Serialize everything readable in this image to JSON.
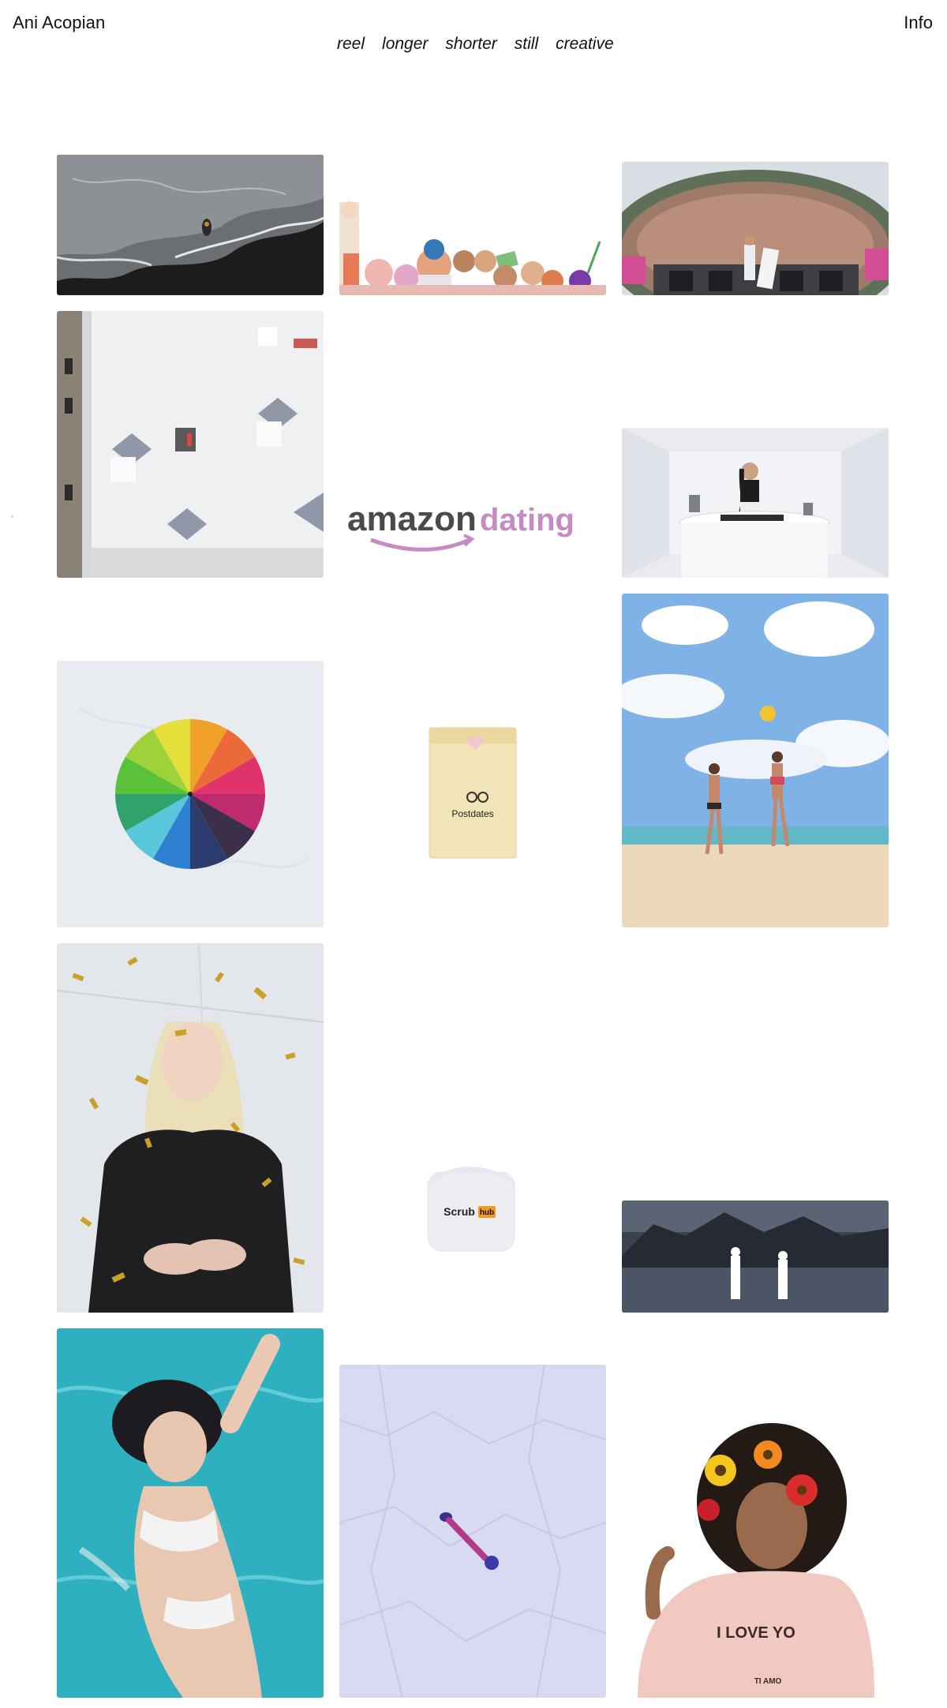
{
  "header": {
    "site_title": "Ani Acopian",
    "info_label": "Info"
  },
  "nav": {
    "items": [
      {
        "label": "reel"
      },
      {
        "label": "longer"
      },
      {
        "label": "shorter"
      },
      {
        "label": "still"
      },
      {
        "label": "creative"
      }
    ]
  },
  "gallery": {
    "amazon_word": "amazon",
    "dating_word": "dating",
    "postdates_label": "Postdates",
    "scrub_label": "Scrub",
    "scrub_badge": "hub",
    "hoodie_text": "I LOVE YO",
    "hoodie_small_text": "TI AMO"
  },
  "colors": {
    "text": "#111111",
    "background": "#ffffff",
    "amazon_dark": "#4a4a4a",
    "dating_pink": "#c58bc3"
  }
}
